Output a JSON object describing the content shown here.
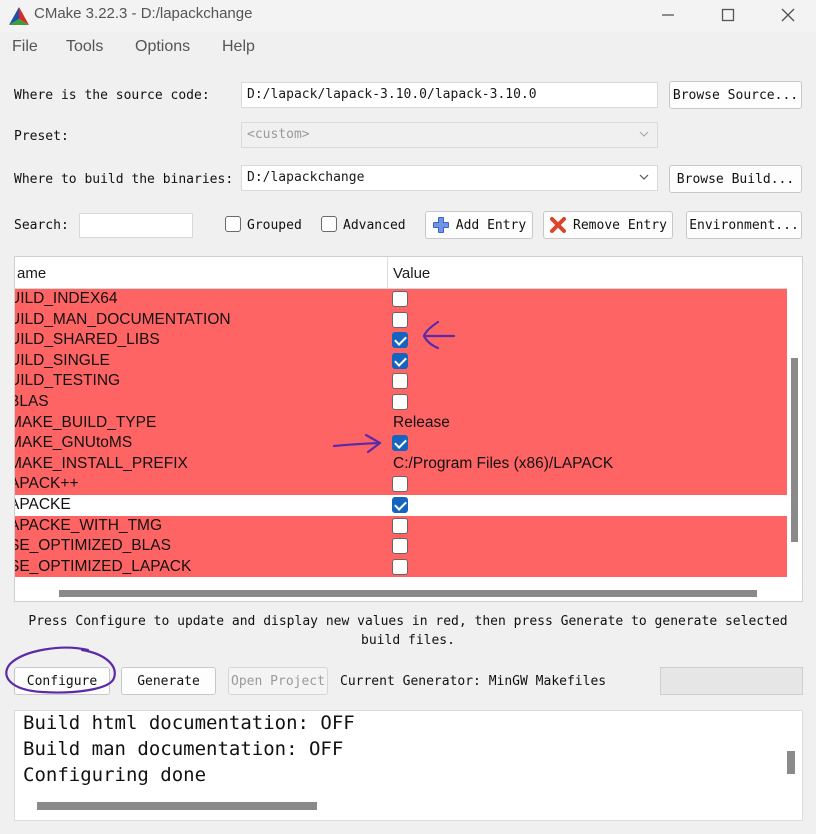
{
  "window": {
    "title": "CMake 3.22.3 - D:/lapackchange",
    "controls": [
      "minimize-icon",
      "maximize-icon",
      "close-icon"
    ]
  },
  "menu": [
    "File",
    "Tools",
    "Options",
    "Help"
  ],
  "form": {
    "source_label": "Where is the source code:",
    "source_value": "D:/lapack/lapack-3.10.0/lapack-3.10.0",
    "browse_source": "Browse Source...",
    "preset_label": "Preset:",
    "preset_value": "<custom>",
    "build_label": "Where to build the binaries:",
    "build_value": "D:/lapackchange",
    "browse_build": "Browse Build...",
    "search_label": "Search:",
    "search_value": "",
    "grouped_label": "Grouped",
    "grouped_checked": false,
    "advanced_label": "Advanced",
    "advanced_checked": false,
    "add_entry": "Add Entry",
    "remove_entry": "Remove Entry",
    "environment": "Environment..."
  },
  "table": {
    "col_name": "ame",
    "col_value": "Value",
    "rows": [
      {
        "name": "UILD_INDEX64",
        "type": "bool",
        "checked": false,
        "highlight": "red"
      },
      {
        "name": "UILD_MAN_DOCUMENTATION",
        "type": "bool",
        "checked": false,
        "highlight": "red"
      },
      {
        "name": "UILD_SHARED_LIBS",
        "type": "bool",
        "checked": true,
        "highlight": "red"
      },
      {
        "name": "UILD_SINGLE",
        "type": "bool",
        "checked": true,
        "highlight": "red"
      },
      {
        "name": "UILD_TESTING",
        "type": "bool",
        "checked": false,
        "highlight": "red"
      },
      {
        "name": "BLAS",
        "type": "bool",
        "checked": false,
        "highlight": "red"
      },
      {
        "name": "MAKE_BUILD_TYPE",
        "type": "text",
        "value": "Release",
        "highlight": "red"
      },
      {
        "name": "MAKE_GNUtoMS",
        "type": "bool",
        "checked": true,
        "highlight": "red"
      },
      {
        "name": "MAKE_INSTALL_PREFIX",
        "type": "text",
        "value": "C:/Program Files (x86)/LAPACK",
        "highlight": "red"
      },
      {
        "name": "APACK++",
        "type": "bool",
        "checked": false,
        "highlight": "red"
      },
      {
        "name": "APACKE",
        "type": "bool",
        "checked": true,
        "highlight": "white"
      },
      {
        "name": "APACKE_WITH_TMG",
        "type": "bool",
        "checked": false,
        "highlight": "red"
      },
      {
        "name": "SE_OPTIMIZED_BLAS",
        "type": "bool",
        "checked": false,
        "highlight": "red"
      },
      {
        "name": "SE_OPTIMIZED_LAPACK",
        "type": "bool",
        "checked": false,
        "highlight": "red"
      }
    ]
  },
  "hint": {
    "line1": "Press Configure to update and display new values in red, then press Generate to generate selected",
    "line2": "build files."
  },
  "actions": {
    "configure": "Configure",
    "generate": "Generate",
    "open_project": "Open Project",
    "generator": "Current Generator: MinGW Makefiles"
  },
  "log": [
    "Build html documentation: OFF",
    "Build man documentation: OFF",
    "Configuring done"
  ],
  "colors": {
    "changed_row": "#ff6464",
    "checkbox_on": "#1565c0",
    "annotation": "#5b2aa8"
  }
}
